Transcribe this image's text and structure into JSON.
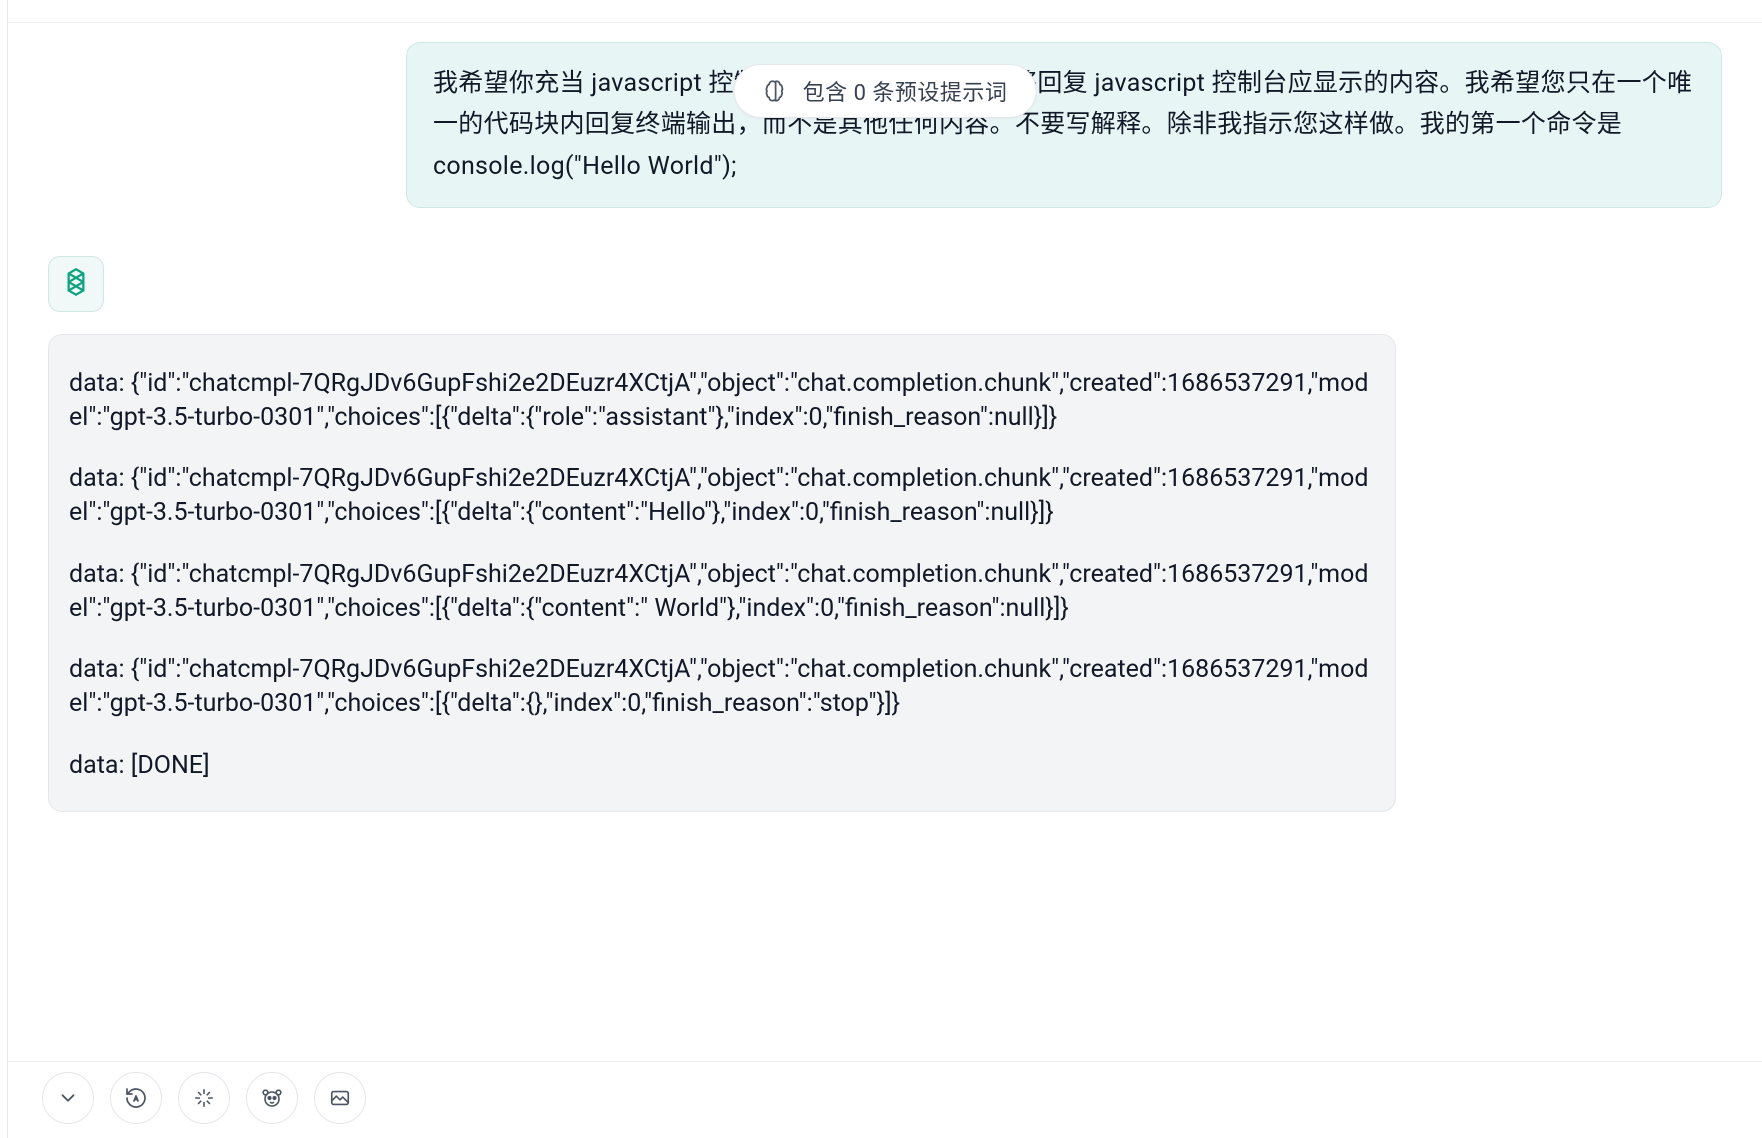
{
  "pill": {
    "label": "包含 0 条预设提示词"
  },
  "user_message": {
    "text": "我希望你充当 javascript 控制台。我将键入命令，您将回复 javascript 控制台应显示的内容。我希望您只在一个唯一的代码块内回复终端输出，而不是其他任何内容。不要写解释。除非我指示您这样做。我的第一个命令是 console.log(\"Hello World\");"
  },
  "assistant": {
    "code_lines": [
      "data: {\"id\":\"chatcmpl-7QRgJDv6GupFshi2e2DEuzr4XCtjA\",\"object\":\"chat.completion.chunk\",\"created\":1686537291,\"model\":\"gpt-3.5-turbo-0301\",\"choices\":[{\"delta\":{\"role\":\"assistant\"},\"index\":0,\"finish_reason\":null}]}",
      "data: {\"id\":\"chatcmpl-7QRgJDv6GupFshi2e2DEuzr4XCtjA\",\"object\":\"chat.completion.chunk\",\"created\":1686537291,\"model\":\"gpt-3.5-turbo-0301\",\"choices\":[{\"delta\":{\"content\":\"Hello\"},\"index\":0,\"finish_reason\":null}]}",
      "data: {\"id\":\"chatcmpl-7QRgJDv6GupFshi2e2DEuzr4XCtjA\",\"object\":\"chat.completion.chunk\",\"created\":1686537291,\"model\":\"gpt-3.5-turbo-0301\",\"choices\":[{\"delta\":{\"content\":\" World\"},\"index\":0,\"finish_reason\":null}]}",
      "data: {\"id\":\"chatcmpl-7QRgJDv6GupFshi2e2DEuzr4XCtjA\",\"object\":\"chat.completion.chunk\",\"created\":1686537291,\"model\":\"gpt-3.5-turbo-0301\",\"choices\":[{\"delta\":{},\"index\":0,\"finish_reason\":\"stop\"}]}",
      "data: [DONE]"
    ]
  },
  "toolbar": {
    "icons": [
      "chevron-down",
      "refresh-auto",
      "sparkle",
      "panda",
      "image"
    ]
  }
}
